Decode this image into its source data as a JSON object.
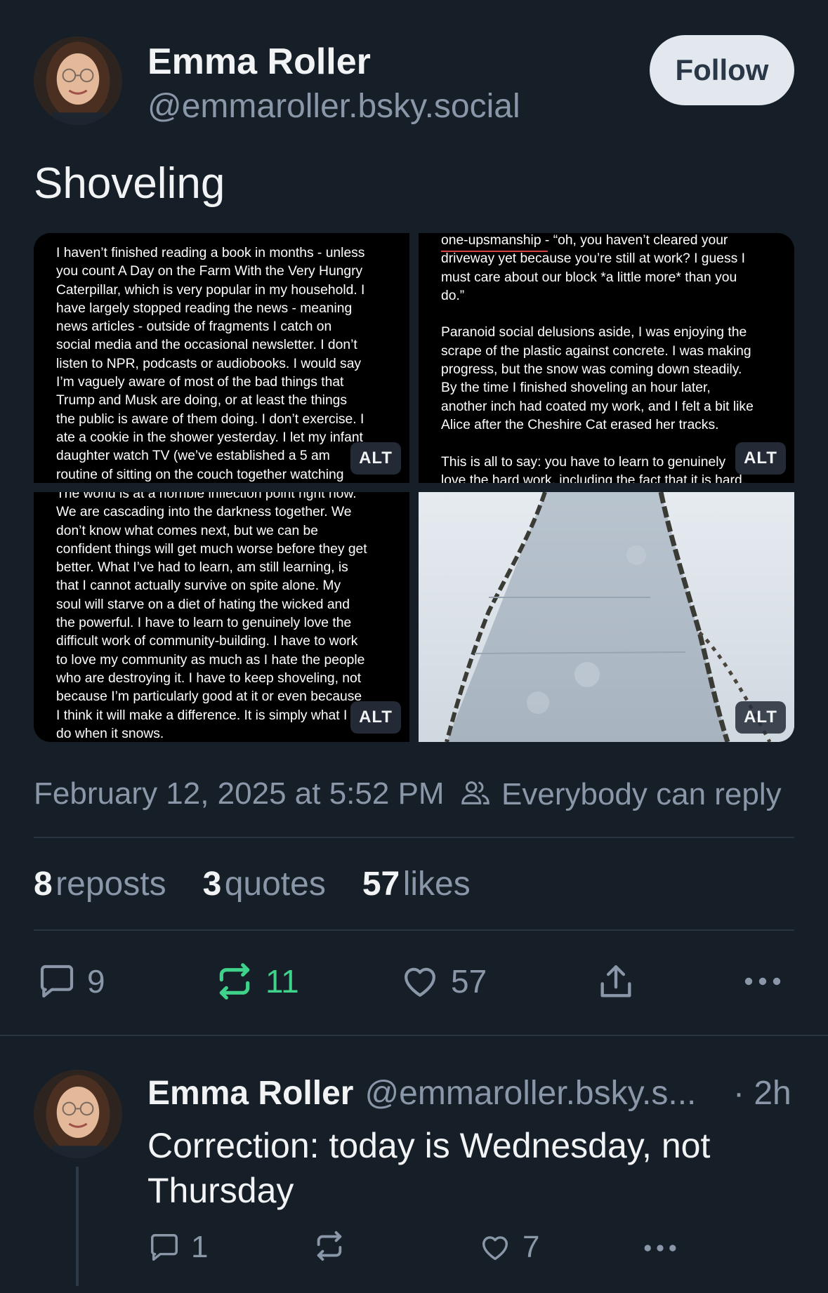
{
  "post": {
    "author_name": "Emma Roller",
    "author_handle": "@emmaroller.bsky.social",
    "follow_label": "Follow",
    "text": "Shoveling",
    "images": [
      {
        "text": "I haven’t finished reading a book in months - unless\nyou count A Day on the Farm With the Very Hungry\nCaterpillar, which is very popular in my household. I\nhave largely stopped reading the news - meaning\nnews articles - outside of fragments I catch on\nsocial media and the occasional newsletter. I don’t\nlisten to NPR, podcasts or audiobooks. I would say\nI’m vaguely aware of most of the bad things that\nTrump and Musk are doing, or at least the things\nthe public is aware of them doing.  I don’t exercise. I\nate a cookie in the shower yesterday. I let my infant\ndaughter watch TV (we’ve established a 5 am\nroutine of sitting on the couch together watching",
        "alt_label": "ALT"
      },
      {
        "text": "one-upsmanship - “oh, you haven’t cleared your\ndriveway yet because you’re still at work? I guess I\nmust care about our block *a little more* than you\ndo.”\n\nParanoid social delusions aside, I was enjoying the\nscrape of the plastic against concrete. I was making\nprogress, but the snow was coming down steadily.\nBy the time I finished shoveling an hour later,\nanother inch had coated my work, and I felt a bit like\nAlice after the Cheshire Cat erased her tracks.\n\nThis is all to say: you have to learn to genuinely\nlove the hard work, including the fact that it is hard.",
        "alt_label": "ALT"
      },
      {
        "text": "The world is at a horrible inflection point right now.\nWe are cascading into the darkness together. We\ndon’t know what comes next, but we can be\nconfident things will get much worse before they get\nbetter. What I’ve had to learn, am still learning, is\nthat I cannot actually survive on spite alone. My\nsoul will starve on a diet of hating the wicked and\nthe powerful. I have to learn to genuinely love the\ndifficult work of community-building. I have to work\nto love my community as much as I hate the people\nwho are destroying it. I have to keep shoveling, not\nbecause I’m particularly good at it or even because\nI think it will make a difference. It is simply what I\ndo when it snows.",
        "alt_label": "ALT"
      },
      {
        "alt_label": "ALT"
      }
    ],
    "timestamp": "February 12, 2025 at 5:52 PM",
    "reply_setting": "Everybody can reply",
    "stats": {
      "reposts_count": "8",
      "reposts_label": "reposts",
      "quotes_count": "3",
      "quotes_label": "quotes",
      "likes_count": "57",
      "likes_label": "likes"
    },
    "actions": {
      "reply_count": "9",
      "repost_count": "11",
      "like_count": "57"
    }
  },
  "reply": {
    "author_name": "Emma Roller",
    "author_handle": "@emmaroller.bsky.s...",
    "time": "· 2h",
    "text": "Correction: today is Wednesday, not Thursday",
    "actions": {
      "reply_count": "1",
      "repost_count": "",
      "like_count": "7"
    }
  },
  "colors": {
    "background": "#161e27",
    "muted_text": "#8a97a8",
    "repost_active": "#3fd28b",
    "follow_bg": "#e3e8ee"
  }
}
